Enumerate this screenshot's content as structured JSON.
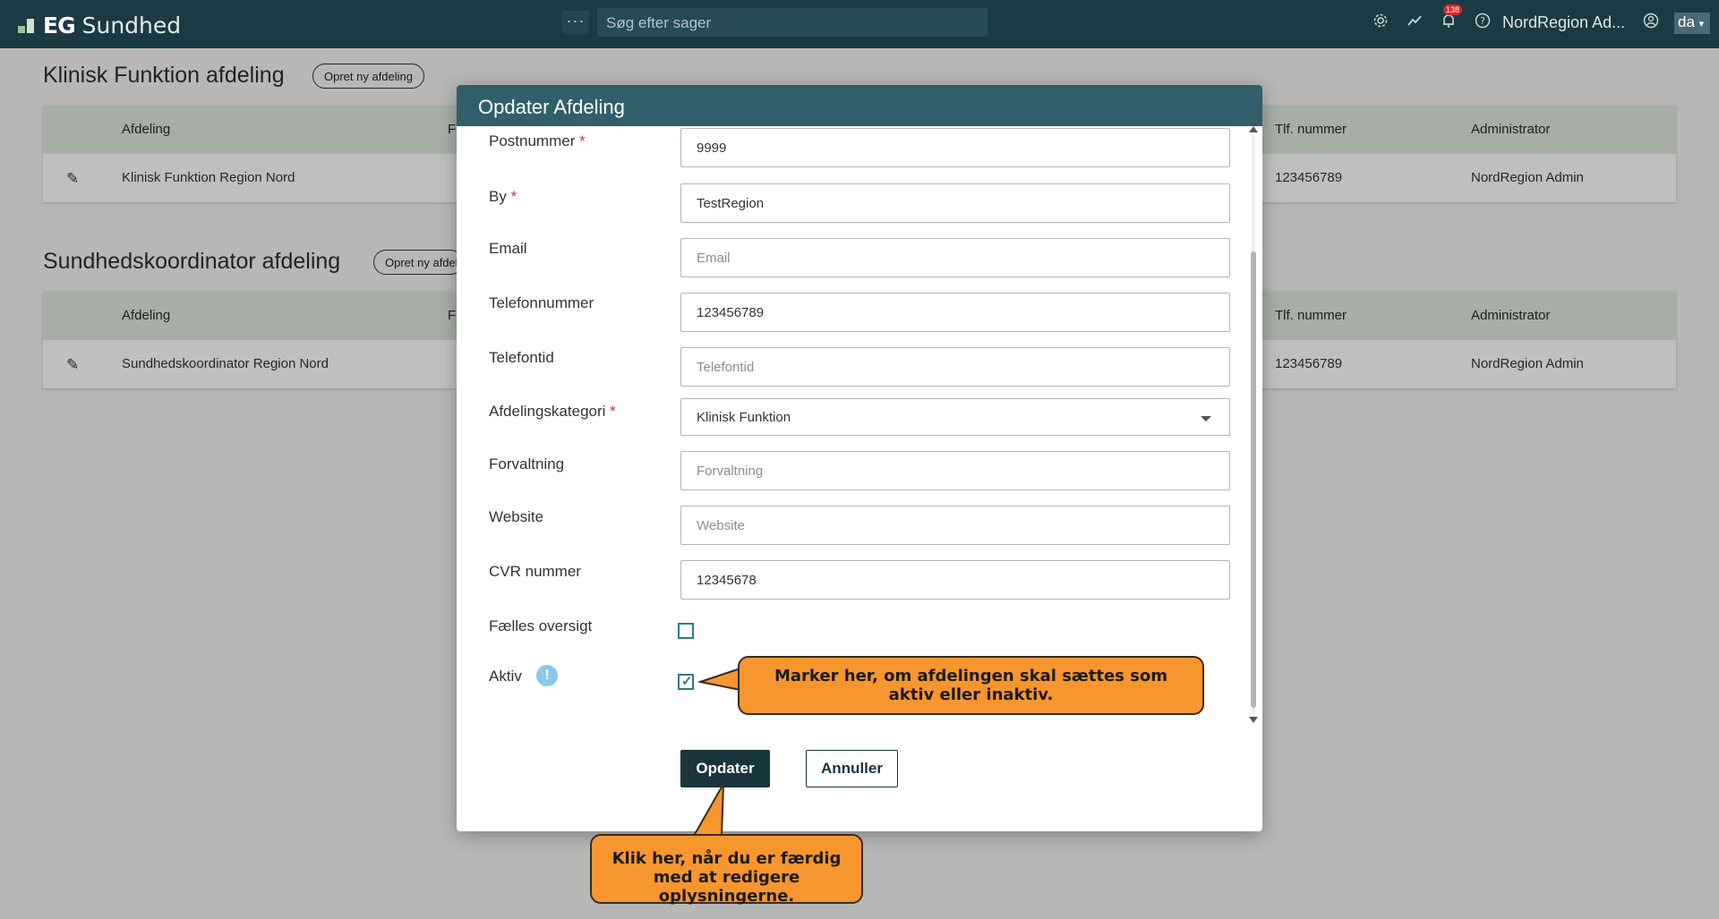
{
  "topbar": {
    "logo_eg": "EG",
    "logo_sundhed": "Sundhed",
    "more_glyph": "···",
    "search_placeholder": "Søg efter sager",
    "icons": [
      "gear-icon",
      "trend-icon",
      "bell-icon",
      "help-icon",
      "user-icon"
    ],
    "notification_count": "138",
    "user_name": "NordRegion Ad...",
    "language": "da",
    "accent_color": "#1b3a44"
  },
  "sections": [
    {
      "title": "Klinisk Funktion afdeling",
      "create_button": "Opret ny afdeling",
      "columns": [
        "Afdeling",
        "Fo",
        "Tlf. nummer",
        "Administrator"
      ],
      "row": {
        "afdeling": "Klinisk Funktion Region Nord",
        "tlf": "123456789",
        "administrator": "NordRegion Admin"
      }
    },
    {
      "title": "Sundhedskoordinator afdeling",
      "create_button": "Opret ny afdeling",
      "columns": [
        "Afdeling",
        "Fo",
        "Tlf. nummer",
        "Administrator"
      ],
      "row": {
        "afdeling": "Sundhedskoordinator Region Nord",
        "tlf": "123456789",
        "administrator": "NordRegion Admin"
      }
    }
  ],
  "modal": {
    "title": "Opdater Afdeling",
    "fields": {
      "postnummer": {
        "label": "Postnummer",
        "value": "9999"
      },
      "by": {
        "label": "By",
        "value": "TestRegion"
      },
      "email": {
        "label": "Email",
        "placeholder": "Email"
      },
      "telefonnummer": {
        "label": "Telefonnummer",
        "value": "123456789"
      },
      "telefontid": {
        "label": "Telefontid",
        "placeholder": "Telefontid"
      },
      "afdelingskategori": {
        "label": "Afdelingskategori",
        "value": "Klinisk Funktion"
      },
      "forvaltning": {
        "label": "Forvaltning",
        "placeholder": "Forvaltning"
      },
      "website": {
        "label": "Website",
        "placeholder": "Website"
      },
      "cvr": {
        "label": "CVR nummer",
        "value": "12345678"
      },
      "faelles": {
        "label": "Fælles oversigt",
        "checked": false
      },
      "aktiv": {
        "label": "Aktiv",
        "checked": true
      }
    },
    "required_mark": "*",
    "info_glyph": "!",
    "update_button": "Opdater",
    "cancel_button": "Annuller"
  },
  "callouts": {
    "aktiv": "Marker her, om afdelingen skal sættes som aktiv eller inaktiv.",
    "update": "Klik her, når du er færdig med at redigere oplysningerne.",
    "color": "#f7962e"
  }
}
